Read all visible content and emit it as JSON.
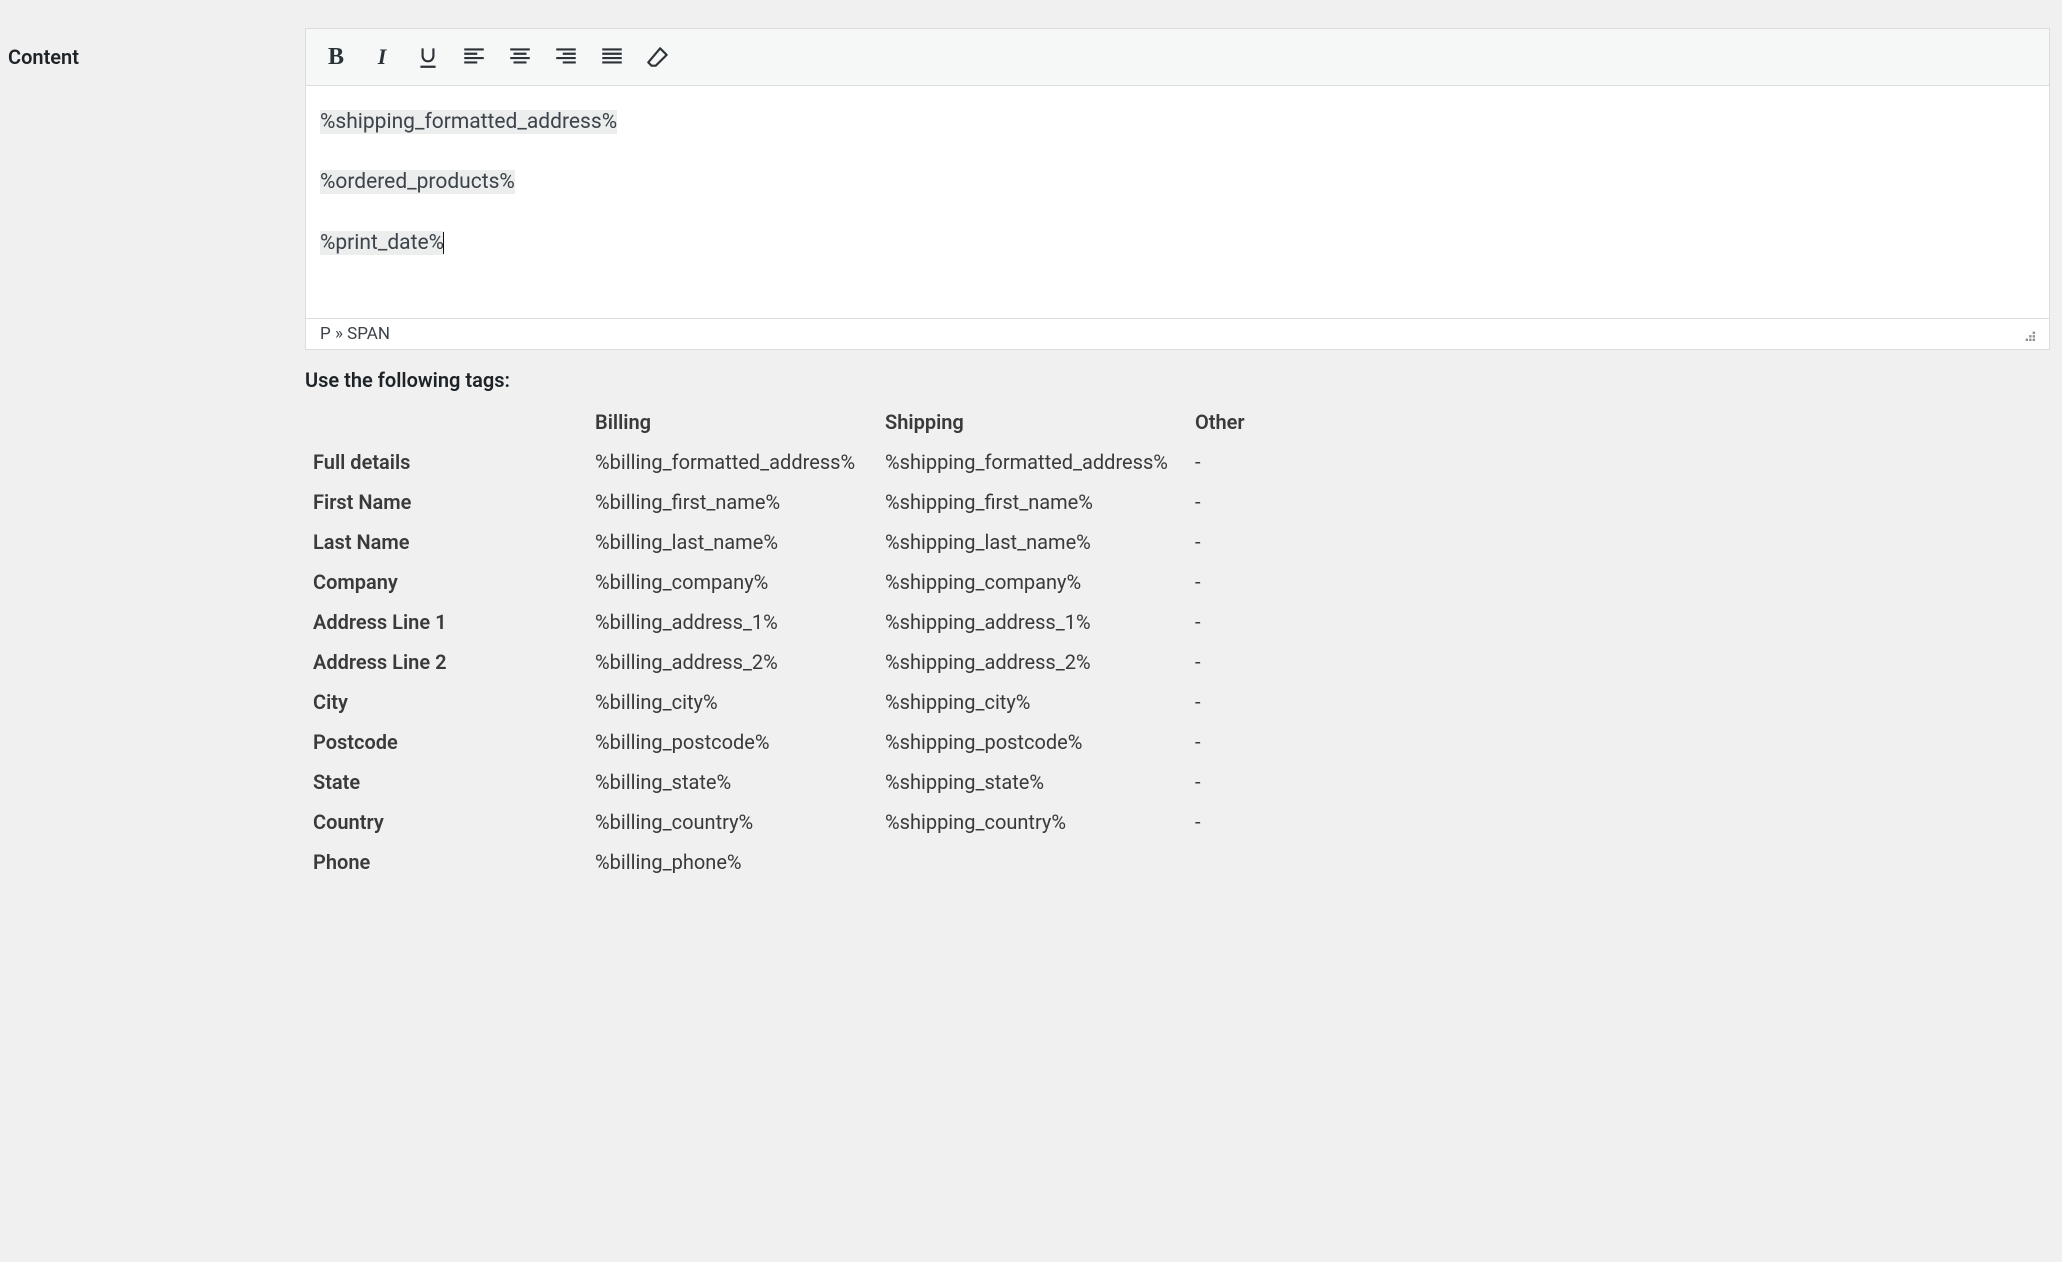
{
  "field_label": "Content",
  "toolbar": {
    "bold": "B",
    "italic": "I"
  },
  "content": {
    "line1": "%shipping_formatted_address%",
    "line2": "%ordered_products%",
    "line3": "%print_date%"
  },
  "status_path": "P » SPAN",
  "tags_heading": "Use the following tags:",
  "headers": {
    "blank": "",
    "billing": "Billing",
    "shipping": "Shipping",
    "other": "Other"
  },
  "rows": [
    {
      "label": "Full details",
      "billing": "%billing_formatted_address%",
      "shipping": "%shipping_formatted_address%",
      "other": "-"
    },
    {
      "label": "First Name",
      "billing": "%billing_first_name%",
      "shipping": "%shipping_first_name%",
      "other": "-"
    },
    {
      "label": "Last Name",
      "billing": "%billing_last_name%",
      "shipping": "%shipping_last_name%",
      "other": "-"
    },
    {
      "label": "Company",
      "billing": "%billing_company%",
      "shipping": "%shipping_company%",
      "other": "-"
    },
    {
      "label": "Address Line 1",
      "billing": "%billing_address_1%",
      "shipping": "%shipping_address_1%",
      "other": "-"
    },
    {
      "label": "Address Line 2",
      "billing": "%billing_address_2%",
      "shipping": "%shipping_address_2%",
      "other": "-"
    },
    {
      "label": "City",
      "billing": "%billing_city%",
      "shipping": "%shipping_city%",
      "other": "-"
    },
    {
      "label": "Postcode",
      "billing": "%billing_postcode%",
      "shipping": "%shipping_postcode%",
      "other": "-"
    },
    {
      "label": "State",
      "billing": "%billing_state%",
      "shipping": "%shipping_state%",
      "other": "-"
    },
    {
      "label": "Country",
      "billing": "%billing_country%",
      "shipping": "%shipping_country%",
      "other": "-"
    },
    {
      "label": "Phone",
      "billing": "%billing_phone%",
      "shipping": "",
      "other": ""
    }
  ]
}
